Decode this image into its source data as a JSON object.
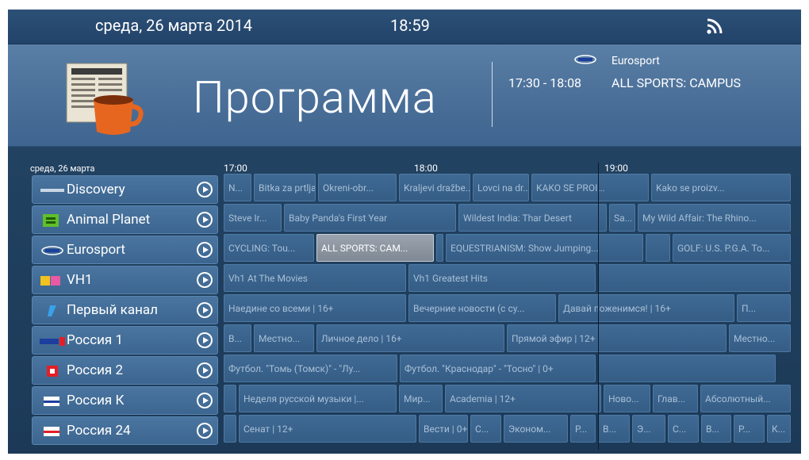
{
  "statusbar": {
    "date": "среда, 26 марта 2014",
    "time": "18:59",
    "rss_icon": "rss-icon"
  },
  "header": {
    "title": "Программа",
    "app_icon": "newspaper-coffee-icon",
    "now": {
      "channel": "Eurosport",
      "time": "17:30 - 18:08",
      "title": "ALL SPORTS: CAMPUS"
    }
  },
  "guide": {
    "date": "среда, 26 марта",
    "ticks": [
      "17:00",
      "18:00",
      "19:00"
    ],
    "channels": [
      {
        "name": "Discovery",
        "logo": "discovery-logo"
      },
      {
        "name": "Animal Planet",
        "logo": "animal-planet-logo"
      },
      {
        "name": "Eurosport",
        "logo": "eurosport-logo"
      },
      {
        "name": "VH1",
        "logo": "vh1-logo"
      },
      {
        "name": "Первый канал",
        "logo": "perviy-kanal-logo"
      },
      {
        "name": "Россия 1",
        "logo": "rossiya-1-logo"
      },
      {
        "name": "Россия 2",
        "logo": "rossiya-2-logo"
      },
      {
        "name": "Россия К",
        "logo": "rossiya-k-logo"
      },
      {
        "name": "Россия 24",
        "logo": "rossiya-24-logo"
      }
    ],
    "rows": [
      [
        {
          "t": "N..."
        },
        {
          "t": "Bitka za prtlja..."
        },
        {
          "t": "Okreni-obr..."
        },
        {
          "t": "Kraljevi dražbe..."
        },
        {
          "t": "Lovci na dr..."
        },
        {
          "t": "KAKO SE PROI..."
        },
        {
          "t": "Kako se proizv..."
        }
      ],
      [
        {
          "t": "Steve Ir..."
        },
        {
          "t": "Baby Panda's First Year"
        },
        {
          "t": "Wildest India: Thar Desert"
        },
        {
          "t": "Sa..."
        },
        {
          "t": "My Wild Affair: The Rhino..."
        }
      ],
      [
        {
          "t": "CYCLING: Tou..."
        },
        {
          "t": "ALL SPORTS: CAM..."
        },
        {
          "t": ""
        },
        {
          "t": "EQUESTRIANISM: Show Jumping..."
        },
        {
          "t": ""
        },
        {
          "t": "GOLF: U.S. P.G.A. To..."
        }
      ],
      [
        {
          "t": "Vh1 At The Movies"
        },
        {
          "t": "Vh1 Greatest Hits"
        },
        {
          "t": ""
        }
      ],
      [
        {
          "t": "Наедине со всеми | 16+"
        },
        {
          "t": "Вечерние новости (с су..."
        },
        {
          "t": "Давай поженимся! | 16+"
        },
        {
          "t": "П..."
        }
      ],
      [
        {
          "t": "В..."
        },
        {
          "t": "Местно..."
        },
        {
          "t": "Личное дело | 16+"
        },
        {
          "t": "Прямой эфир | 12+"
        },
        {
          "t": "Местно..."
        }
      ],
      [
        {
          "t": "Футбол. \"Томь (Томск)\" - \"Лу..."
        },
        {
          "t": "Футбол. \"Краснодар\" - \"Тосно\" | 0+"
        },
        {
          "t": ""
        }
      ],
      [
        {
          "t": ""
        },
        {
          "t": "Неделя русской музыки |..."
        },
        {
          "t": "Мир..."
        },
        {
          "t": "Academia | 12+"
        },
        {
          "t": "Ново..."
        },
        {
          "t": "Глав..."
        },
        {
          "t": "Абсолютный..."
        }
      ],
      [
        {
          "t": ""
        },
        {
          "t": "Сенат | 12+"
        },
        {
          "t": "Вести | 0+"
        },
        {
          "t": "С..."
        },
        {
          "t": "Эконом..."
        },
        {
          "t": "Р..."
        },
        {
          "t": "В..."
        },
        {
          "t": "Э..."
        },
        {
          "t": "С..."
        },
        {
          "t": "В..."
        },
        {
          "t": "Р..."
        },
        {
          "t": "К..."
        }
      ]
    ]
  },
  "colors": {
    "background": "#20405f",
    "header": "#4a6f98",
    "cell": "#3a648e",
    "selected": "#8d96a1"
  }
}
